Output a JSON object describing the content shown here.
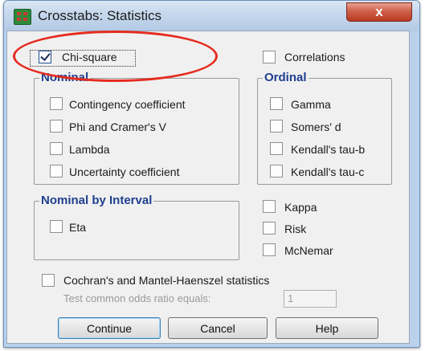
{
  "window": {
    "title": "Crosstabs: Statistics",
    "close_glyph": "x"
  },
  "top": {
    "chi_square": "Chi-square",
    "chi_square_checked": true,
    "correlations": "Correlations"
  },
  "nominal": {
    "legend": "Nominal",
    "items": [
      "Contingency coefficient",
      "Phi and Cramer's V",
      "Lambda",
      "Uncertainty coefficient"
    ]
  },
  "ordinal": {
    "legend": "Ordinal",
    "items": [
      "Gamma",
      "Somers' d",
      "Kendall's tau-b",
      "Kendall's tau-c"
    ]
  },
  "nominal_by_interval": {
    "legend": "Nominal by Interval",
    "items": [
      "Eta"
    ]
  },
  "other": {
    "items": [
      "Kappa",
      "Risk",
      "McNemar"
    ]
  },
  "cochran": {
    "label": "Cochran's and Mantel-Haenszel statistics",
    "odds_label": "Test common odds ratio equals:",
    "odds_value": "1"
  },
  "buttons": {
    "continue": "Continue",
    "cancel": "Cancel",
    "help": "Help"
  },
  "colors": {
    "highlight": "#e52b1f",
    "legend_text": "#1f3f8f",
    "close_button": "#c8503a"
  },
  "icons": {
    "app": "spss-crosstabs-icon",
    "close": "close-icon"
  }
}
